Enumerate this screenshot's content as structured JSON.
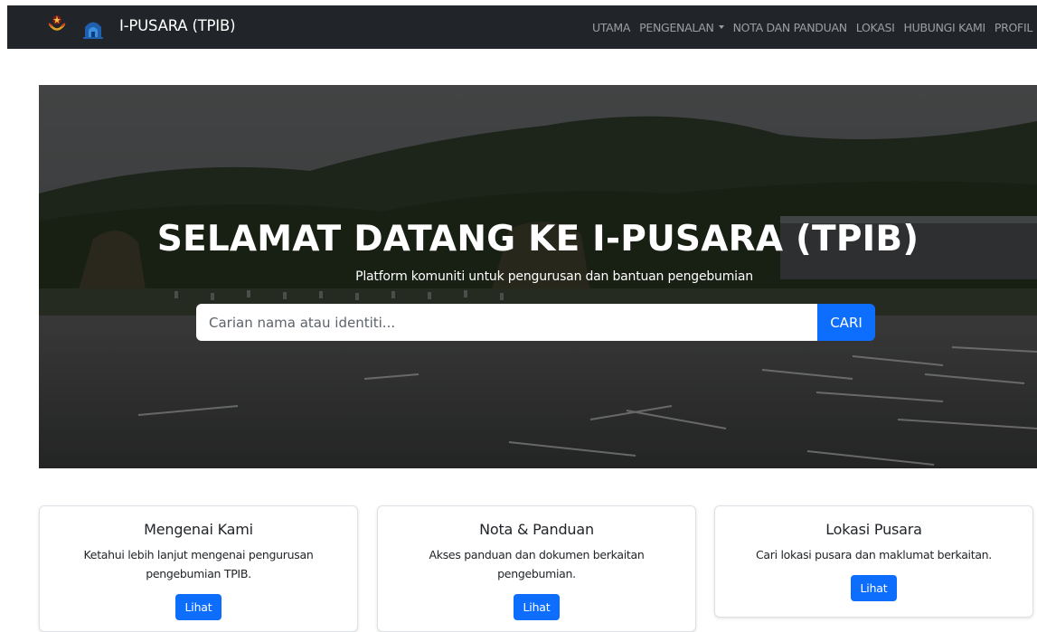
{
  "navbar": {
    "brand": "I-PUSARA (TPIB)",
    "links": [
      {
        "label": "UTAMA"
      },
      {
        "label": "PENGENALAN",
        "dropdown": true
      },
      {
        "label": "NOTA DAN PANDUAN"
      },
      {
        "label": "LOKASI"
      },
      {
        "label": "HUBUNGI KAMI"
      },
      {
        "label": "PROFIL"
      }
    ]
  },
  "hero": {
    "title": "SELAMAT DATANG KE I-PUSARA (TPIB)",
    "subtitle": "Platform komuniti untuk pengurusan dan bantuan pengebumian",
    "search": {
      "placeholder": "Carian nama atau identiti...",
      "value": "",
      "button_label": "CARI"
    }
  },
  "cards": [
    {
      "title": "Mengenai Kami",
      "text": "Ketahui lebih lanjut mengenai pengurusan pengebumian TPIB.",
      "button_label": "Lihat"
    },
    {
      "title": "Nota & Panduan",
      "text": "Akses panduan dan dokumen berkaitan pengebumian.",
      "button_label": "Lihat"
    },
    {
      "title": "Lokasi Pusara",
      "text": "Cari lokasi pusara dan maklumat berkaitan.",
      "button_label": "Lihat"
    }
  ],
  "colors": {
    "navbar_bg": "#212529",
    "primary": "#0d6efd",
    "card_border": "#dee2e6"
  },
  "icons": [
    "crest-logo",
    "mosque-logo",
    "chevron-down-icon"
  ]
}
